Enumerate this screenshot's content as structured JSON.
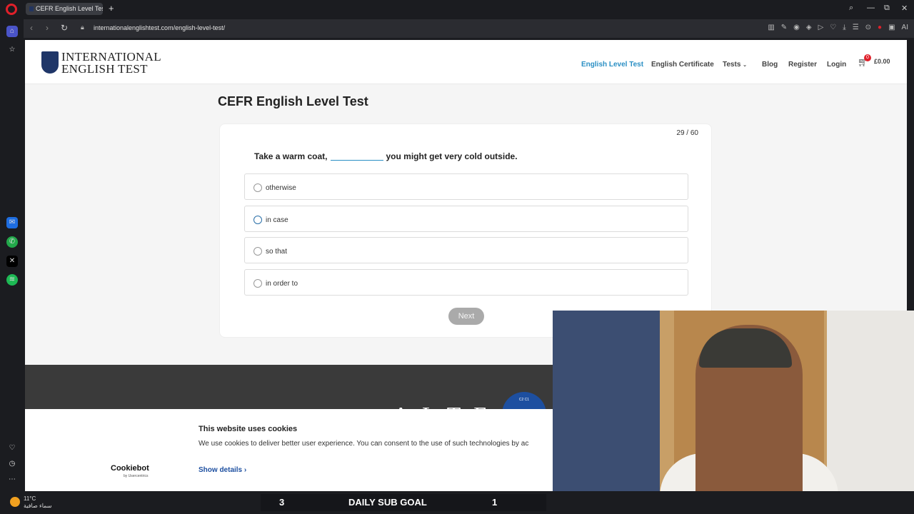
{
  "browser": {
    "tab_title": "CEFR English Level Test - I",
    "new_tab": "+",
    "url": "internationalenglishtest.com/english-level-test/",
    "window_controls": [
      "⌕",
      "—",
      "⧉",
      "✕"
    ],
    "toolbar_icons": [
      "▥",
      "✎",
      "◉",
      "◈",
      "▷",
      "♡",
      "⤓",
      "☰",
      "⊙",
      "●",
      "▣",
      "AI"
    ]
  },
  "site": {
    "logo_line1": "INTERNATIONAL",
    "logo_line2": "ENGLISH TEST",
    "nav": [
      "English Level Test",
      "English Certificate",
      "Tests",
      "Blog",
      "Register",
      "Login"
    ],
    "cart_count": "0",
    "cart_total": "£0.00"
  },
  "test": {
    "title": "CEFR English Level Test",
    "counter": "29 / 60",
    "question_before": "Take a warm coat,",
    "question_after": "you might get very cold outside.",
    "options": [
      "otherwise",
      "in case",
      "so that",
      "in order to"
    ],
    "next_label": "Next"
  },
  "footer": {
    "alte": "ALTE",
    "badge": "C2 C1"
  },
  "cookie": {
    "title": "This website uses cookies",
    "text": "We use cookies to deliver better user experience. You can consent to the use of such technologies by ac",
    "brand": "Cookiebot",
    "brand_sub": "by Usercentrics",
    "show_details": "Show details"
  },
  "taskbar": {
    "temp": "11°C",
    "weather": "سماء صافية"
  },
  "goal": {
    "left": "3",
    "label": "DAILY SUB GOAL",
    "right": "1"
  }
}
